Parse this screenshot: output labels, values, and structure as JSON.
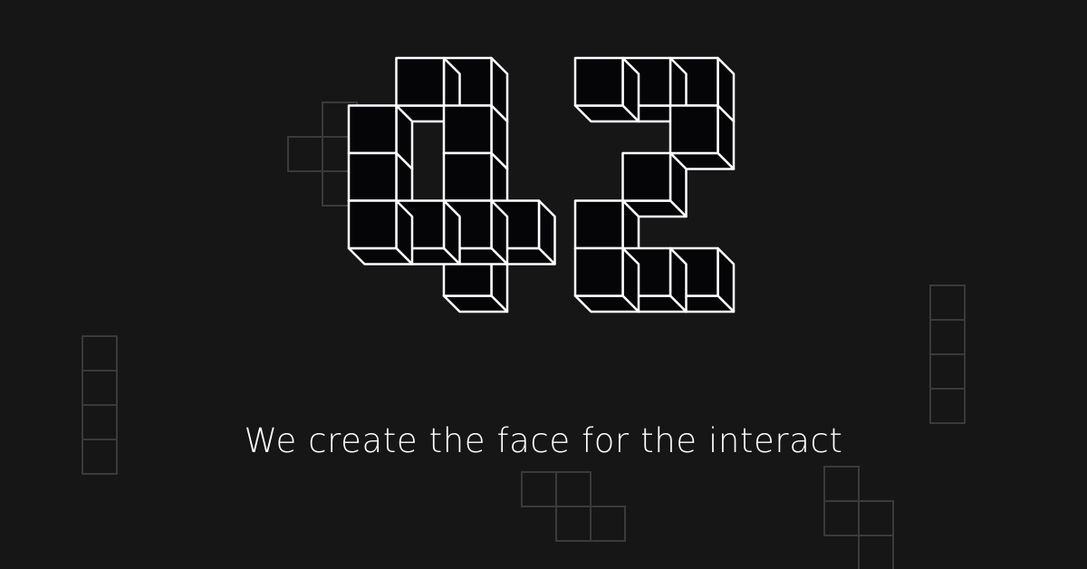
{
  "tagline": "We create the face for the interact",
  "colors": {
    "background": "#161616",
    "cube_face": "#050507",
    "cube_edge": "#ffffff",
    "decor_edge": "#3a3a3a",
    "text": "#ffffff"
  },
  "logo": {
    "graphic": "isometric-cube-digits-42",
    "glyphs": [
      "4",
      "2"
    ]
  },
  "decorations": [
    "tetromino-t",
    "tetromino-i",
    "tetromino-i",
    "tetromino-s",
    "tetromino-s"
  ]
}
